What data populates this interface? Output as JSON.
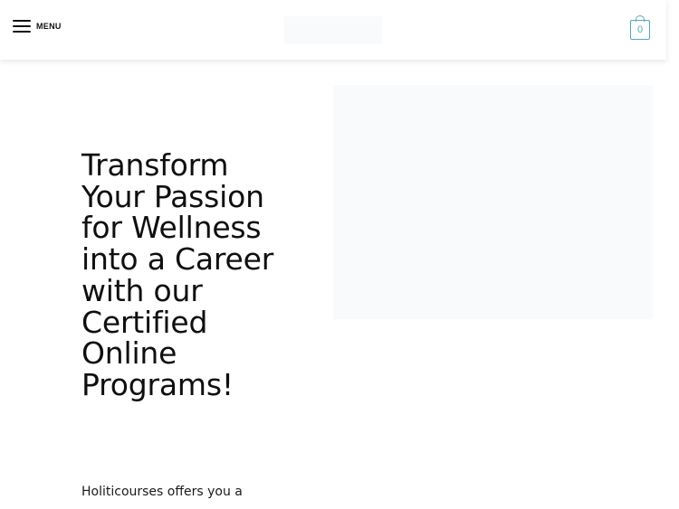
{
  "header": {
    "menu_label": "MENU",
    "cart_count": "0"
  },
  "icons": {
    "menu": "hamburger-icon",
    "cart": "shopping-bag-icon"
  },
  "colors": {
    "accent": "#58a6bd",
    "placeholder_bg": "#f9fafb",
    "text": "#0f0f0f"
  },
  "hero": {
    "title": "Transform Your Passion for Wellness into a Career with our Certified Online Programs!",
    "intro": "Holiticourses offers you a"
  }
}
